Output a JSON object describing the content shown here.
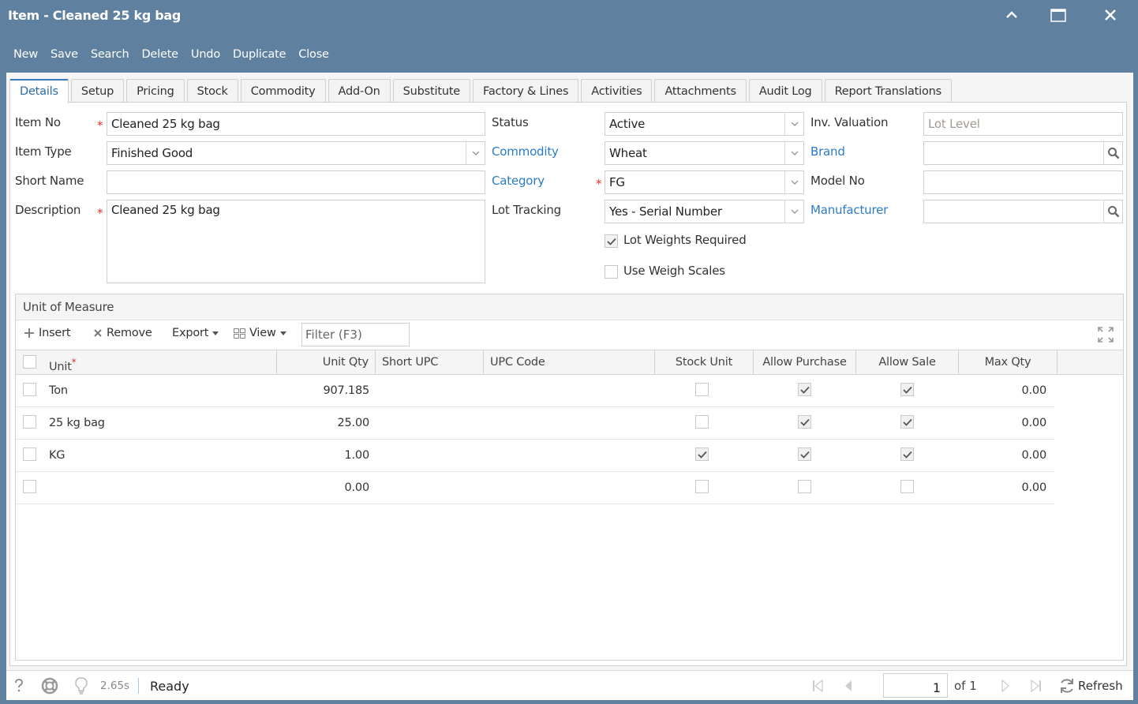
{
  "window": {
    "title": "Item - Cleaned 25 kg bag",
    "controls": [
      "collapse",
      "maximize",
      "close"
    ]
  },
  "toolbar": {
    "buttons": [
      "New",
      "Save",
      "Search",
      "Delete",
      "Undo",
      "Duplicate",
      "Close"
    ]
  },
  "tabs": [
    {
      "label": "Details",
      "active": true
    },
    {
      "label": "Setup"
    },
    {
      "label": "Pricing"
    },
    {
      "label": "Stock"
    },
    {
      "label": "Commodity"
    },
    {
      "label": "Add-On"
    },
    {
      "label": "Substitute"
    },
    {
      "label": "Factory & Lines"
    },
    {
      "label": "Activities"
    },
    {
      "label": "Attachments"
    },
    {
      "label": "Audit Log"
    },
    {
      "label": "Report Translations"
    }
  ],
  "form": {
    "item_no": {
      "label": "Item No",
      "value": "Cleaned 25 kg bag",
      "required": true
    },
    "item_type": {
      "label": "Item Type",
      "value": "Finished Good"
    },
    "short_name": {
      "label": "Short Name",
      "value": ""
    },
    "description": {
      "label": "Description",
      "value": "Cleaned 25 kg bag",
      "required": true
    },
    "status": {
      "label": "Status",
      "value": "Active"
    },
    "commodity": {
      "label": "Commodity",
      "value": "Wheat"
    },
    "category": {
      "label": "Category",
      "value": "FG",
      "required": true
    },
    "lot_tracking": {
      "label": "Lot Tracking",
      "value": "Yes - Serial Number"
    },
    "lot_weights_required": {
      "label": "Lot Weights Required",
      "checked": true
    },
    "use_weigh_scales": {
      "label": "Use Weigh Scales",
      "checked": false
    },
    "inv_valuation": {
      "label": "Inv. Valuation",
      "placeholder": "Lot Level"
    },
    "brand": {
      "label": "Brand",
      "value": ""
    },
    "model_no": {
      "label": "Model No",
      "value": ""
    },
    "manufacturer": {
      "label": "Manufacturer",
      "value": ""
    }
  },
  "uom": {
    "title": "Unit of Measure",
    "tools": {
      "insert": "Insert",
      "remove": "Remove",
      "export": "Export",
      "view": "View",
      "filter_placeholder": "Filter (F3)"
    },
    "columns": [
      "Unit",
      "Unit Qty",
      "Short UPC",
      "UPC Code",
      "Stock Unit",
      "Allow Purchase",
      "Allow Sale",
      "Max Qty"
    ],
    "rows": [
      {
        "unit": "Ton",
        "unit_qty": "907.185",
        "short_upc": "",
        "upc_code": "",
        "stock_unit": false,
        "allow_purchase": true,
        "allow_sale": true,
        "max_qty": "0.00"
      },
      {
        "unit": "25 kg bag",
        "unit_qty": "25.00",
        "short_upc": "",
        "upc_code": "",
        "stock_unit": false,
        "allow_purchase": true,
        "allow_sale": true,
        "max_qty": "0.00"
      },
      {
        "unit": "KG",
        "unit_qty": "1.00",
        "short_upc": "",
        "upc_code": "",
        "stock_unit": true,
        "allow_purchase": true,
        "allow_sale": true,
        "max_qty": "0.00"
      },
      {
        "unit": "",
        "unit_qty": "0.00",
        "short_upc": "",
        "upc_code": "",
        "stock_unit": false,
        "allow_purchase": false,
        "allow_sale": false,
        "max_qty": "0.00"
      }
    ]
  },
  "statusbar": {
    "time": "2.65s",
    "status": "Ready",
    "page": "1",
    "of_pages": "of 1",
    "refresh": "Refresh"
  }
}
